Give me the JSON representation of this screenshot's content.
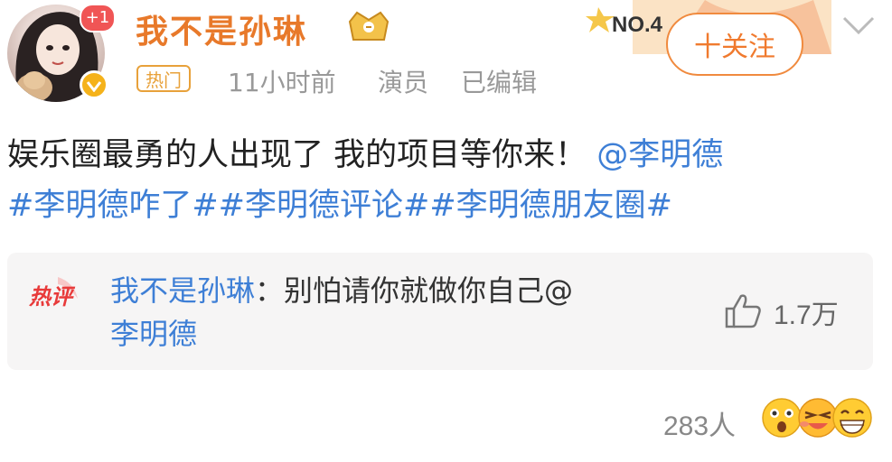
{
  "header": {
    "username": "我不是孙琳",
    "avatar_badge": "+1",
    "tag": "热门",
    "time": "11小时前",
    "role": "演员",
    "edited": "已编辑",
    "rank_label": "NO.4",
    "follow_label": "十关注"
  },
  "post": {
    "text_line1": "娱乐圈最勇的人出现了 我的项目等你来！",
    "mention": "@李明德",
    "hashtags": [
      "#李明德咋了#",
      "#李明德评论#",
      "#李明德朋友圈#"
    ]
  },
  "hot_comment": {
    "label": "热评",
    "author": "我不是孙琳",
    "text_line1": "：别怕请你就做你自己@",
    "text_line2": "李明德",
    "like_count": "1.7万"
  },
  "footer": {
    "reaction_count": "283人"
  },
  "colors": {
    "username": "#e8792a",
    "link": "#3e7fd6",
    "follow": "#f07a2e",
    "meta": "#999999"
  }
}
